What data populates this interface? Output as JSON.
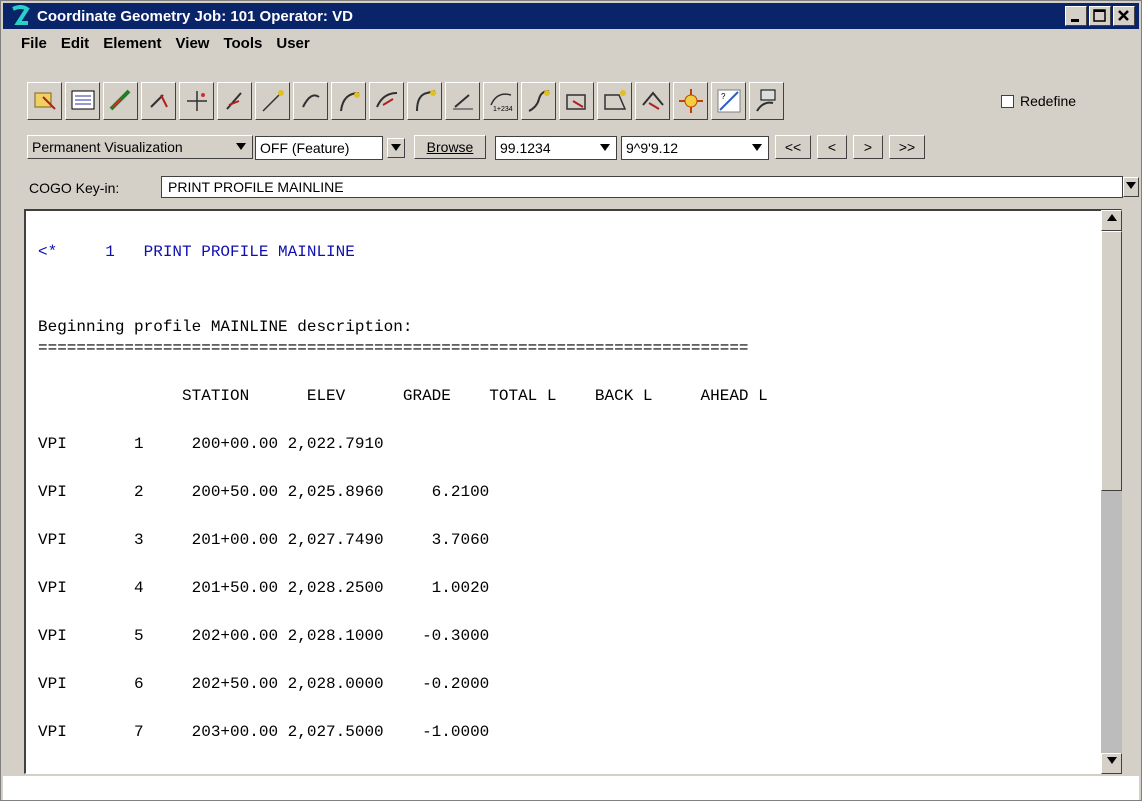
{
  "titlebar": {
    "title": "Coordinate Geometry   Job: 101   Operator: VD"
  },
  "menu": [
    "File",
    "Edit",
    "Element",
    "View",
    "Tools",
    "User"
  ],
  "toolbar": {
    "tools": [
      "locate-point-icon",
      "list-icon",
      "draw-tool-icon",
      "locate-hook-icon",
      "add-point-icon",
      "locate-line-icon",
      "store-line-icon",
      "locate-curve-icon",
      "store-curve-icon",
      "locate-spiral-icon",
      "store-spiral-icon",
      "locate-chain-icon",
      "store-chain-icon",
      "locate-parcel-icon",
      "store-parcel-icon",
      "locate-profile-icon",
      "store-profile-icon",
      "visualize-icon",
      "element-edit-icon",
      "import-icon"
    ],
    "redefine_label": "Redefine"
  },
  "row2": {
    "visualization": "Permanent Visualization",
    "feature": "OFF (Feature)",
    "browse": "Browse",
    "value1": "99.1234",
    "value2": "9^9'9.12",
    "nav_first": "<<",
    "nav_prev": "<",
    "nav_next": ">",
    "nav_last": ">>"
  },
  "keyin": {
    "label": "COGO Key-in:",
    "value": "PRINT PROFILE MAINLINE"
  },
  "output": {
    "command": "<*     1   PRINT PROFILE MAINLINE",
    "heading": "Beginning profile MAINLINE description:",
    "rule": "==========================================================================",
    "columns": "               STATION      ELEV      GRADE    TOTAL L    BACK L     AHEAD L",
    "rows": [
      "VPI       1     200+00.00 2,022.7910",
      "VPI       2     200+50.00 2,025.8960     6.2100",
      "VPI       3     201+00.00 2,027.7490     3.7060",
      "VPI       4     201+50.00 2,028.2500     1.0020",
      "VPI       5     202+00.00 2,028.1000    -0.3000",
      "VPI       6     202+50.00 2,028.0000    -0.2000",
      "VPI       7     203+00.00 2,027.5000    -1.0000"
    ]
  }
}
